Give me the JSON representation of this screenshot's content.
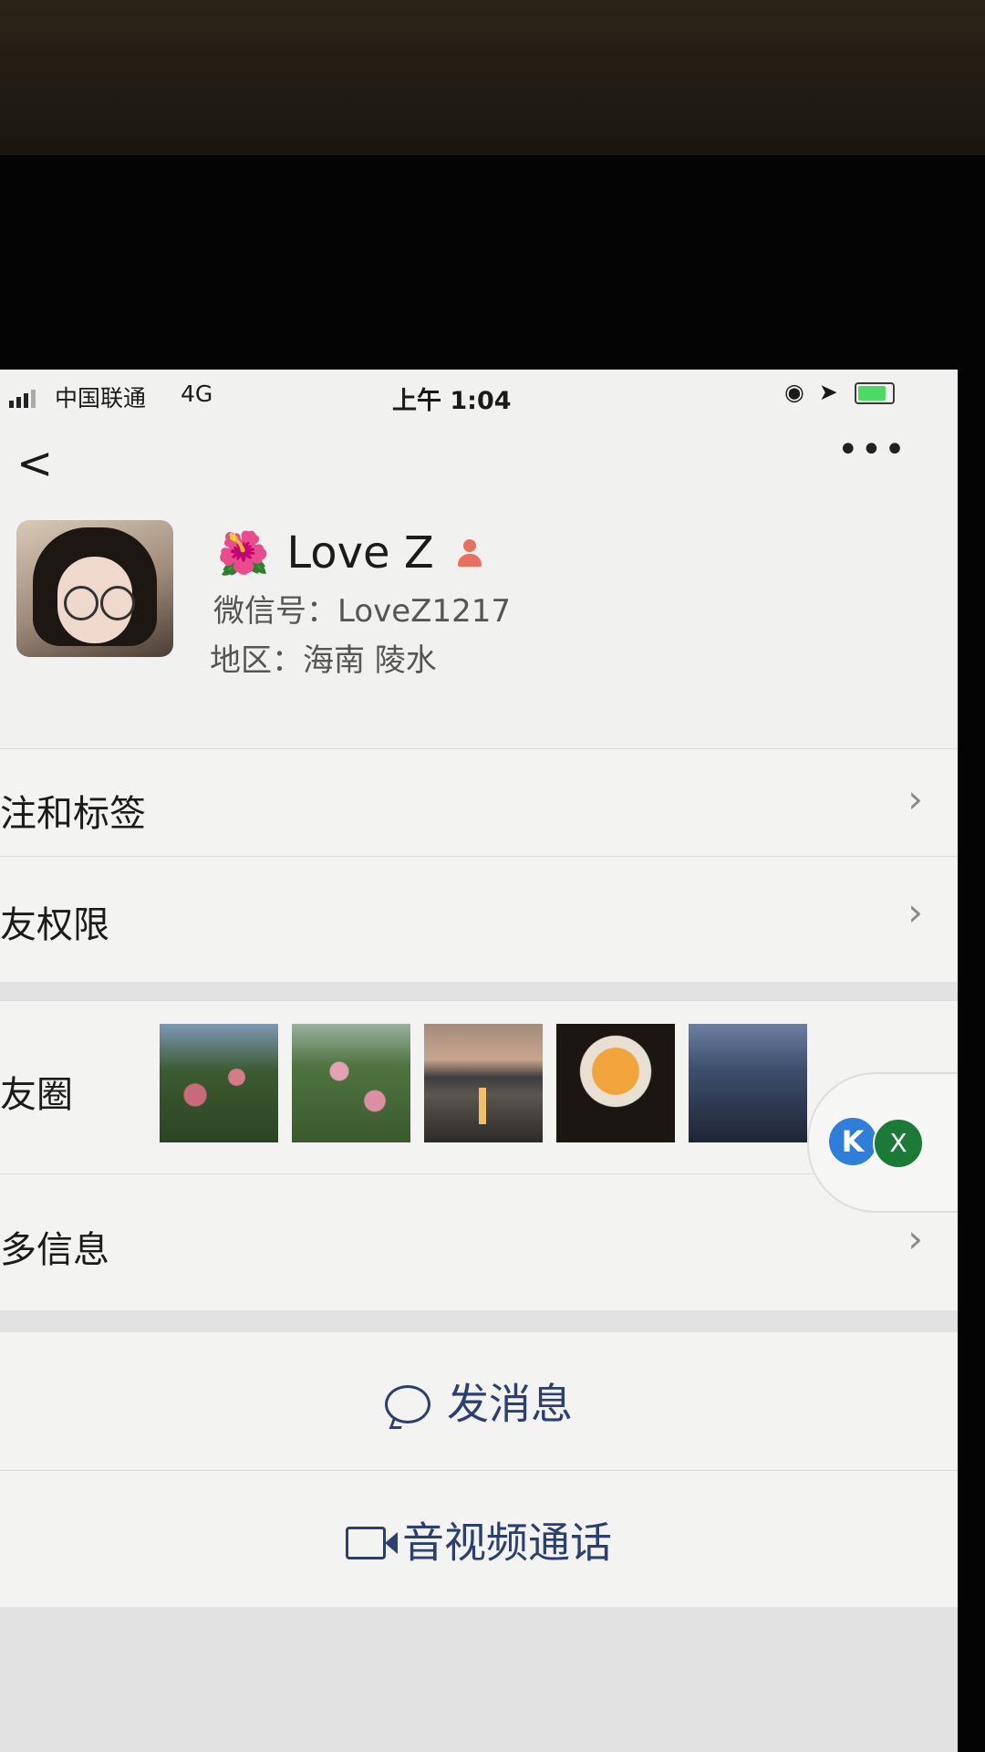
{
  "status_bar": {
    "carrier": "中国联通",
    "network": "4G",
    "time": "上午 1:04"
  },
  "nav": {
    "back_label": "<",
    "more_label": "•••"
  },
  "profile": {
    "flower_emoji": "🌺",
    "name": "Love Z",
    "wechat_id": "微信号：LoveZ1217",
    "region": "地区：海南 陵水"
  },
  "menu": {
    "remarks_tags": "备注和标签",
    "moments_permissions": "朋友权限",
    "moments": "朋友圈",
    "more_info": "更多信息",
    "chevron": "›"
  },
  "floater": {
    "badge_1": "K",
    "badge_2": "X"
  },
  "actions": {
    "send_message": "发消息",
    "video_call": "音视频通话"
  },
  "colors": {
    "link_blue": "#2b3f70",
    "gender_female": "#e9705e"
  }
}
